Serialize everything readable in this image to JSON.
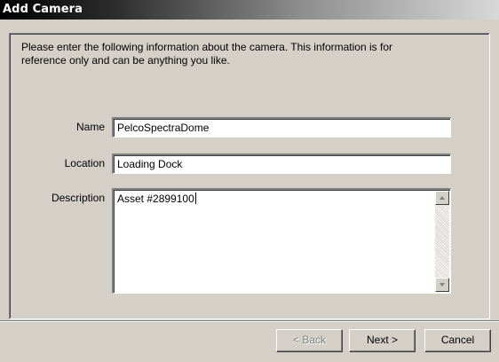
{
  "window": {
    "title": "Add Camera"
  },
  "intro": {
    "line1": "Please enter the following information about the camera.  This information is for",
    "line2": "reference only and can be anything you like."
  },
  "form": {
    "name_label": "Name",
    "name_value": "PelcoSpectraDome",
    "location_label": "Location",
    "location_value": "Loading Dock",
    "description_label": "Description",
    "description_value": "Asset #2899100"
  },
  "buttons": {
    "back_label": "< Back",
    "next_label": "Next >",
    "cancel_label": "Cancel"
  },
  "icons": {
    "scroll_up": "scroll-up-arrow-icon",
    "scroll_down": "scroll-down-arrow-icon"
  }
}
